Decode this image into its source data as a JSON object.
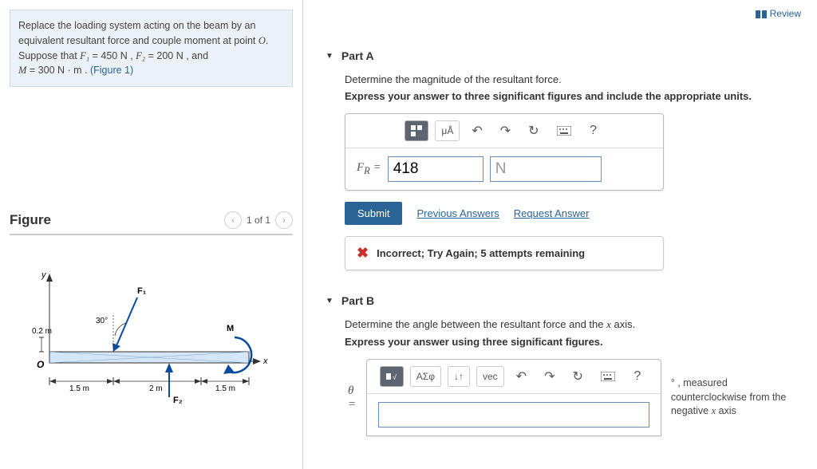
{
  "review_label": "Review",
  "problem": {
    "line1_a": "Replace the loading system acting on the beam by an equivalent resultant force and couple moment at point ",
    "pointO": "O",
    "line1_b": ".",
    "line2_a": "Suppose that ",
    "F1": "F₁",
    "eq1": " = 450  N , ",
    "F2": "F₂",
    "eq2": " = 200  N , and",
    "line3_a": "M",
    "eq3": " = 300  N · m . ",
    "fig_link": "(Figure 1)"
  },
  "figure": {
    "title": "Figure",
    "counter": "1 of 1",
    "labels": {
      "y": "y",
      "x": "x",
      "O": "O",
      "F1": "F₁",
      "F2": "F₂",
      "M": "M",
      "angle": "30°",
      "h": "0.2 m",
      "d1": "1.5 m",
      "d2": "2 m",
      "d3": "1.5 m"
    }
  },
  "partA": {
    "title": "Part A",
    "prompt": "Determine the magnitude of the resultant force.",
    "instructions": "Express your answer to three significant figures and include the appropriate units.",
    "toolbar_mu": "μÅ",
    "toolbar_q": "?",
    "var_label": "Fᴿ =",
    "value": "418",
    "unit": "N",
    "submit": "Submit",
    "prev_answers": "Previous Answers",
    "request_answer": "Request Answer",
    "feedback": "Incorrect; Try Again; 5 attempts remaining"
  },
  "partB": {
    "title": "Part B",
    "prompt_a": "Determine the angle between the resultant force and the ",
    "prompt_var": "x",
    "prompt_b": " axis.",
    "instructions": "Express your answer using three significant figures.",
    "toolbar_sigma": "ΑΣφ",
    "toolbar_arrows": "↓↑",
    "toolbar_vec": "vec",
    "toolbar_q": "?",
    "var_label": "θ =",
    "suffix_a": "° , measured counterclockwise from the negative ",
    "suffix_var": "x",
    "suffix_b": " axis"
  }
}
